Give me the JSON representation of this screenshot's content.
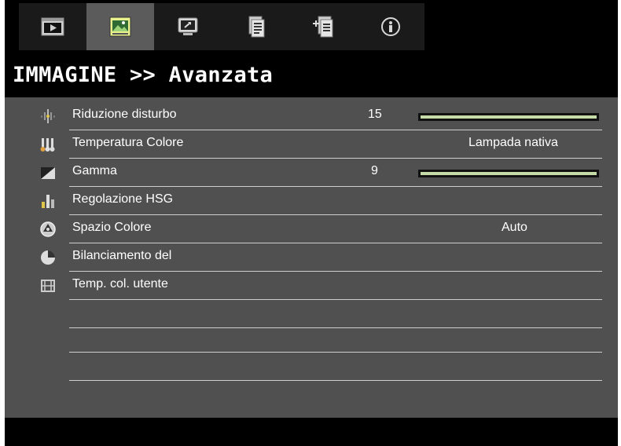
{
  "tabs": [
    {
      "name": "tab-image-playback",
      "icon": "play-screen-icon",
      "active": false
    },
    {
      "name": "tab-image",
      "icon": "picture-icon",
      "active": true
    },
    {
      "name": "tab-display",
      "icon": "monitor-icon",
      "active": false
    },
    {
      "name": "tab-setup",
      "icon": "document-icon",
      "active": false
    },
    {
      "name": "tab-options",
      "icon": "document-plus-icon",
      "active": false
    },
    {
      "name": "tab-info",
      "icon": "info-icon",
      "active": false
    }
  ],
  "header": {
    "title": "IMMAGINE >> Avanzata"
  },
  "menu": {
    "rows": [
      {
        "label": "Riduzione disturbo",
        "icon": "noise-reduction-icon",
        "num": "15",
        "slider": 1.0
      },
      {
        "label": "Temperatura Colore",
        "icon": "color-temperature-icon",
        "value": "Lampada nativa"
      },
      {
        "label": "Gamma",
        "icon": "gamma-icon",
        "num": "9",
        "slider": 1.0
      },
      {
        "label": "Regolazione HSG",
        "icon": "hsg-bars-icon"
      },
      {
        "label": "Spazio Colore",
        "icon": "color-space-icon",
        "value": "Auto"
      },
      {
        "label": "Bilanciamento del",
        "icon": "white-balance-icon"
      },
      {
        "label": "Temp. col. utente",
        "icon": "film-strip-icon"
      }
    ]
  },
  "colors": {
    "accent_fill": "#c7dba8",
    "panel_bg": "#505050",
    "active_tab": "#5b5b5b"
  }
}
